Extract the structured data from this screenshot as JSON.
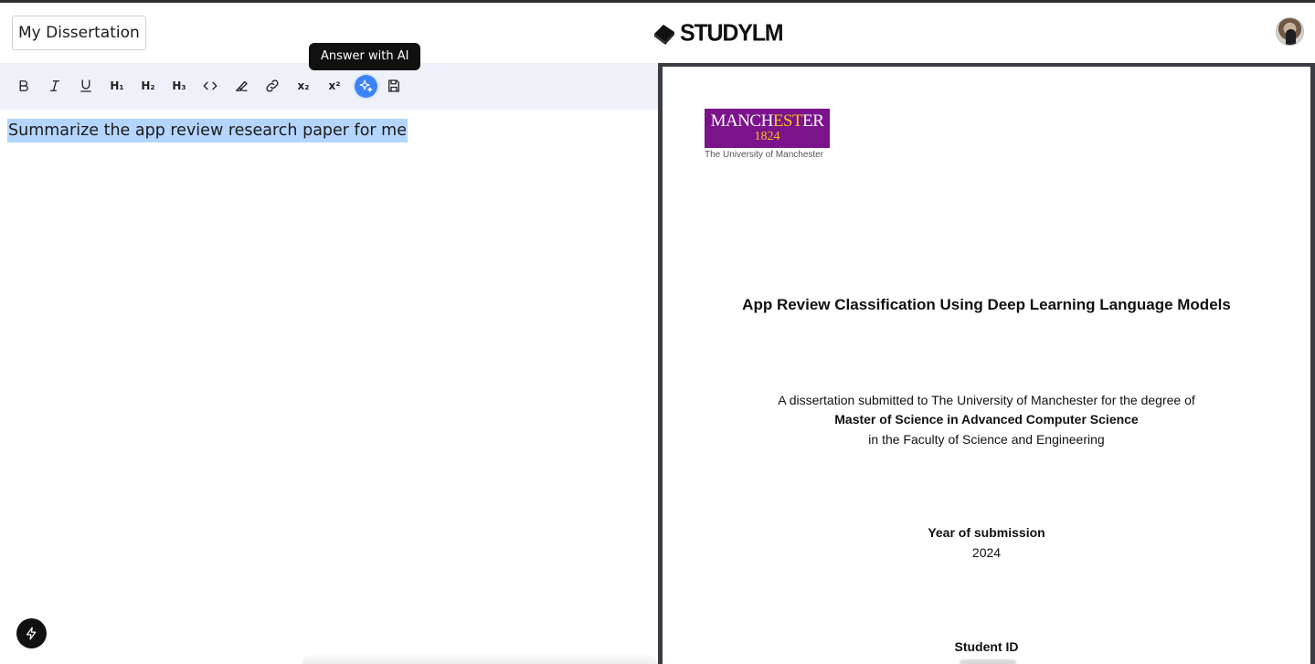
{
  "header": {
    "doc_title": "My Dissertation",
    "brand": "STUDYLM"
  },
  "toolbar": {
    "buttons": [
      {
        "name": "bold",
        "icon": "bold-icon"
      },
      {
        "name": "italic",
        "icon": "italic-icon"
      },
      {
        "name": "underline",
        "icon": "underline-icon"
      },
      {
        "name": "h1",
        "label": "H₁"
      },
      {
        "name": "h2",
        "label": "H₂"
      },
      {
        "name": "h3",
        "label": "H₃"
      },
      {
        "name": "code",
        "icon": "code-icon"
      },
      {
        "name": "highlight",
        "icon": "highlighter-icon"
      },
      {
        "name": "link",
        "icon": "link-icon"
      },
      {
        "name": "subscript",
        "label": "x₂"
      },
      {
        "name": "superscript",
        "label": "x²"
      },
      {
        "name": "ai",
        "icon": "sparkle-icon"
      },
      {
        "name": "save",
        "icon": "save-icon"
      }
    ],
    "tooltip": "Answer with AI",
    "accent_color": "#3b82f6"
  },
  "editor": {
    "selected_text": "Summarize the app review research paper for me",
    "selection_color": "#b4d5fe"
  },
  "pdf": {
    "university_logo": {
      "name_part1": "MANCH",
      "name_part2": "EST",
      "name_part3": "ER",
      "year": "1824",
      "subtitle": "The University of Manchester",
      "color": "#7b138b"
    },
    "title": "App Review Classification Using Deep Learning Language Models",
    "submitted_line": "A dissertation submitted to The University of Manchester for the degree of",
    "degree": "Master of Science in Advanced Computer Science",
    "faculty": "in the Faculty of Science and Engineering",
    "year_label": "Year of submission",
    "year": "2024",
    "student_id_label": "Student ID"
  }
}
